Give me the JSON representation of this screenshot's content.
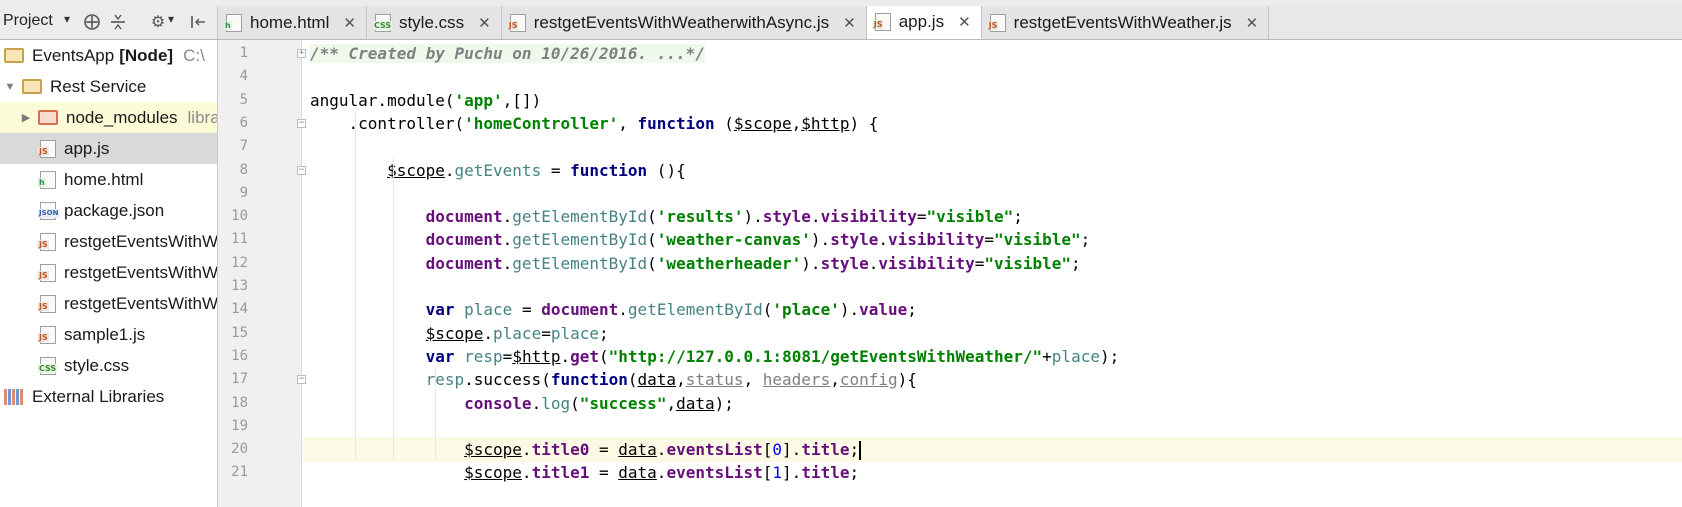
{
  "project_panel": {
    "title": "Project",
    "tools": [
      "target-icon",
      "collapse-icon",
      "gear-icon",
      "hide-icon"
    ]
  },
  "tabs": [
    {
      "name": "home.html",
      "type": "html",
      "active": false
    },
    {
      "name": "style.css",
      "type": "css",
      "active": false
    },
    {
      "name": "restgetEventsWithWeatherwithAsync.js",
      "type": "js",
      "active": false
    },
    {
      "name": "app.js",
      "type": "js",
      "active": true
    },
    {
      "name": "restgetEventsWithWeather.js",
      "type": "js",
      "active": false
    }
  ],
  "tree": [
    {
      "label": "EventsApp",
      "bold": "[Node]",
      "path": "C:\\",
      "icon": "folder",
      "indent": 0,
      "arrow": ""
    },
    {
      "label": "Rest Service",
      "icon": "folder",
      "indent": 1,
      "arrow": "down"
    },
    {
      "label": "node_modules",
      "path": "library root",
      "icon": "folder-red",
      "indent": 2,
      "arrow": "right",
      "highlight": true
    },
    {
      "label": "app.js",
      "icon": "js",
      "indent": 3,
      "selected": true
    },
    {
      "label": "home.html",
      "icon": "html",
      "indent": 3
    },
    {
      "label": "package.json",
      "icon": "json",
      "indent": 3
    },
    {
      "label": "restgetEventsWithWeather.js",
      "icon": "js",
      "indent": 3
    },
    {
      "label": "restgetEventsWithWeatherwithAsync.js",
      "icon": "js",
      "indent": 3
    },
    {
      "label": "restgetEventsWithWeatherAsync.js",
      "icon": "js",
      "indent": 3
    },
    {
      "label": "sample1.js",
      "icon": "js",
      "indent": 3
    },
    {
      "label": "style.css",
      "icon": "css",
      "indent": 3
    },
    {
      "label": "External Libraries",
      "icon": "lib",
      "indent": 0
    }
  ],
  "editor": {
    "current_line": 20,
    "lines": [
      {
        "n": "1",
        "fold": "+",
        "tokens": [
          [
            "cmtbox",
            "/** Created by Puchu on 10/26/2016. ...*/"
          ]
        ]
      },
      {
        "n": "4",
        "tokens": []
      },
      {
        "n": "5",
        "tokens": [
          [
            "plain",
            "angular.module("
          ],
          [
            "str",
            "'app'"
          ],
          [
            "plain",
            ",[])"
          ]
        ]
      },
      {
        "n": "6",
        "fold": "-",
        "tokens": [
          [
            "plain",
            "    .controller("
          ],
          [
            "str",
            "'homeController'"
          ],
          [
            "plain",
            ", "
          ],
          [
            "kw",
            "function"
          ],
          [
            "plain",
            " ("
          ],
          [
            "und",
            "$scope"
          ],
          [
            "plain",
            ","
          ],
          [
            "und",
            "$http"
          ],
          [
            "plain",
            ") {"
          ]
        ]
      },
      {
        "n": "7",
        "tokens": []
      },
      {
        "n": "8",
        "fold": "-",
        "tokens": [
          [
            "plain",
            "        "
          ],
          [
            "und",
            "$scope"
          ],
          [
            "plain",
            "."
          ],
          [
            "fn",
            "getEvents"
          ],
          [
            "plain",
            " = "
          ],
          [
            "kw",
            "function"
          ],
          [
            "plain",
            " (){"
          ]
        ]
      },
      {
        "n": "9",
        "tokens": []
      },
      {
        "n": "10",
        "tokens": [
          [
            "plain",
            "            "
          ],
          [
            "prop",
            "document"
          ],
          [
            "plain",
            "."
          ],
          [
            "fn",
            "getElementById"
          ],
          [
            "plain",
            "("
          ],
          [
            "str",
            "'results'"
          ],
          [
            "plain",
            ")."
          ],
          [
            "prop",
            "style"
          ],
          [
            "plain",
            "."
          ],
          [
            "prop",
            "visibility"
          ],
          [
            "plain",
            "="
          ],
          [
            "str",
            "\"visible\""
          ],
          [
            "plain",
            ";"
          ]
        ]
      },
      {
        "n": "11",
        "tokens": [
          [
            "plain",
            "            "
          ],
          [
            "prop",
            "document"
          ],
          [
            "plain",
            "."
          ],
          [
            "fn",
            "getElementById"
          ],
          [
            "plain",
            "("
          ],
          [
            "str",
            "'weather-canvas'"
          ],
          [
            "plain",
            ")."
          ],
          [
            "prop",
            "style"
          ],
          [
            "plain",
            "."
          ],
          [
            "prop",
            "visibility"
          ],
          [
            "plain",
            "="
          ],
          [
            "str",
            "\"visible\""
          ],
          [
            "plain",
            ";"
          ]
        ]
      },
      {
        "n": "12",
        "tokens": [
          [
            "plain",
            "            "
          ],
          [
            "prop",
            "document"
          ],
          [
            "plain",
            "."
          ],
          [
            "fn",
            "getElementById"
          ],
          [
            "plain",
            "("
          ],
          [
            "str",
            "'weatherheader'"
          ],
          [
            "plain",
            ")."
          ],
          [
            "prop",
            "style"
          ],
          [
            "plain",
            "."
          ],
          [
            "prop",
            "visibility"
          ],
          [
            "plain",
            "="
          ],
          [
            "str",
            "\"visible\""
          ],
          [
            "plain",
            ";"
          ]
        ]
      },
      {
        "n": "13",
        "tokens": []
      },
      {
        "n": "14",
        "tokens": [
          [
            "plain",
            "            "
          ],
          [
            "kw",
            "var"
          ],
          [
            "plain",
            " "
          ],
          [
            "var",
            "place"
          ],
          [
            "plain",
            " = "
          ],
          [
            "prop",
            "document"
          ],
          [
            "plain",
            "."
          ],
          [
            "fn",
            "getElementById"
          ],
          [
            "plain",
            "("
          ],
          [
            "str",
            "'place'"
          ],
          [
            "plain",
            ")."
          ],
          [
            "prop",
            "value"
          ],
          [
            "plain",
            ";"
          ]
        ]
      },
      {
        "n": "15",
        "tokens": [
          [
            "plain",
            "            "
          ],
          [
            "und",
            "$scope"
          ],
          [
            "plain",
            "."
          ],
          [
            "var",
            "place"
          ],
          [
            "plain",
            "="
          ],
          [
            "var",
            "place"
          ],
          [
            "plain",
            ";"
          ]
        ]
      },
      {
        "n": "16",
        "tokens": [
          [
            "plain",
            "            "
          ],
          [
            "kw",
            "var"
          ],
          [
            "plain",
            " "
          ],
          [
            "var",
            "resp"
          ],
          [
            "plain",
            "="
          ],
          [
            "und",
            "$http"
          ],
          [
            "plain",
            "."
          ],
          [
            "prop",
            "get"
          ],
          [
            "plain",
            "("
          ],
          [
            "str",
            "\"http://127.0.0.1:8081/getEventsWithWeather/\""
          ],
          [
            "plain",
            "+"
          ],
          [
            "var",
            "place"
          ],
          [
            "plain",
            ");"
          ]
        ]
      },
      {
        "n": "17",
        "fold": "-",
        "tokens": [
          [
            "plain",
            "            "
          ],
          [
            "var",
            "resp"
          ],
          [
            "plain",
            ".success("
          ],
          [
            "kw",
            "function"
          ],
          [
            "plain",
            "("
          ],
          [
            "param",
            "data"
          ],
          [
            "plain",
            ","
          ],
          [
            "uparam",
            "status"
          ],
          [
            "plain",
            ", "
          ],
          [
            "uparam",
            "headers"
          ],
          [
            "plain",
            ","
          ],
          [
            "uparam",
            "config"
          ],
          [
            "plain",
            "){"
          ]
        ]
      },
      {
        "n": "18",
        "tokens": [
          [
            "plain",
            "                "
          ],
          [
            "prop",
            "console"
          ],
          [
            "plain",
            "."
          ],
          [
            "fn",
            "log"
          ],
          [
            "plain",
            "("
          ],
          [
            "str",
            "\"success\""
          ],
          [
            "plain",
            ","
          ],
          [
            "param",
            "data"
          ],
          [
            "plain",
            ");"
          ]
        ]
      },
      {
        "n": "19",
        "tokens": []
      },
      {
        "n": "20",
        "tokens": [
          [
            "plain",
            "                "
          ],
          [
            "und",
            "$scope"
          ],
          [
            "plain",
            "."
          ],
          [
            "prop",
            "title0"
          ],
          [
            "plain",
            " = "
          ],
          [
            "param",
            "data"
          ],
          [
            "plain",
            "."
          ],
          [
            "prop",
            "eventsList"
          ],
          [
            "plain",
            "["
          ],
          [
            "num",
            "0"
          ],
          [
            "plain",
            "]."
          ],
          [
            "prop",
            "title"
          ],
          [
            "plain",
            ";"
          ],
          [
            "caret",
            ""
          ]
        ]
      },
      {
        "n": "21",
        "tokens": [
          [
            "plain",
            "                "
          ],
          [
            "und",
            "$scope"
          ],
          [
            "plain",
            "."
          ],
          [
            "prop",
            "title1"
          ],
          [
            "plain",
            " = "
          ],
          [
            "param",
            "data"
          ],
          [
            "plain",
            "."
          ],
          [
            "prop",
            "eventsList"
          ],
          [
            "plain",
            "["
          ],
          [
            "num",
            "1"
          ],
          [
            "plain",
            "]."
          ],
          [
            "prop",
            "title"
          ],
          [
            "plain",
            ";"
          ]
        ]
      }
    ]
  }
}
